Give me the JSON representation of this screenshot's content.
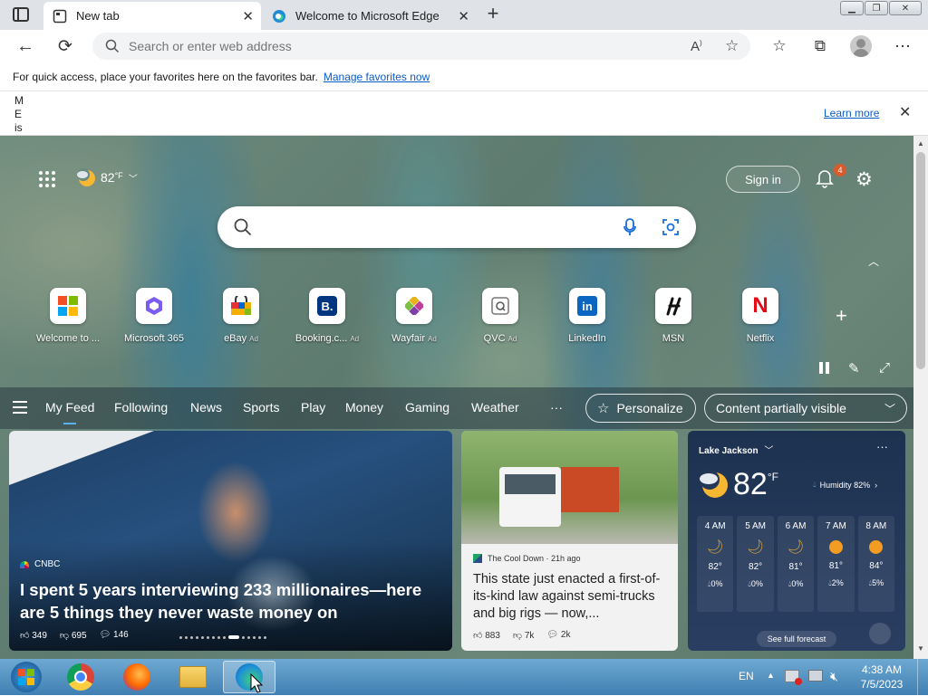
{
  "tabs": [
    {
      "title": "New tab",
      "active": true
    },
    {
      "title": "Welcome to Microsoft Edge",
      "active": false
    }
  ],
  "address_bar": {
    "placeholder": "Search or enter web address"
  },
  "favorites_bar": {
    "message": "For quick access, place your favorites here on the favorites bar.",
    "link": "Manage favorites now"
  },
  "infobar": {
    "partial_text": [
      "M",
      "E",
      "is"
    ],
    "learn_more": "Learn more"
  },
  "ntp": {
    "weather_temp": "82",
    "weather_unit": "°F",
    "sign_in": "Sign in",
    "notification_count": "4",
    "quick_links": [
      {
        "label": "Welcome to ...",
        "ad": ""
      },
      {
        "label": "Microsoft 365",
        "ad": ""
      },
      {
        "label": "eBay",
        "ad": "Ad"
      },
      {
        "label": "Booking.c...",
        "ad": "Ad"
      },
      {
        "label": "Wayfair",
        "ad": "Ad"
      },
      {
        "label": "QVC",
        "ad": "Ad"
      },
      {
        "label": "LinkedIn",
        "ad": ""
      },
      {
        "label": "MSN",
        "ad": ""
      },
      {
        "label": "Netflix",
        "ad": ""
      }
    ],
    "feed_tabs": [
      "My Feed",
      "Following",
      "News",
      "Sports",
      "Play",
      "Money",
      "Gaming",
      "Weather"
    ],
    "more": "···",
    "personalize": "Personalize",
    "content_visibility": "Content partially visible"
  },
  "cards": {
    "main": {
      "source": "CNBC",
      "headline": "I spent 5 years interviewing 233 millionaires—here are 5 things they never waste money on",
      "likes": "349",
      "dislikes": "695",
      "comments": "146"
    },
    "second": {
      "source": "The Cool Down · 21h ago",
      "headline": "This state just enacted a first-of-its-kind law against semi-trucks and big rigs — now,...",
      "likes": "883",
      "dislikes": "7k",
      "comments": "2k"
    },
    "weather": {
      "location": "Lake Jackson",
      "temp": "82",
      "unit": "°F",
      "humidity": "Humidity 82%",
      "forecast_link": "See full forecast",
      "hours": [
        {
          "time": "4 AM",
          "temp": "82°",
          "precip": "0%",
          "icon": "moon"
        },
        {
          "time": "5 AM",
          "temp": "82°",
          "precip": "0%",
          "icon": "moon"
        },
        {
          "time": "6 AM",
          "temp": "81°",
          "precip": "0%",
          "icon": "moon"
        },
        {
          "time": "7 AM",
          "temp": "81°",
          "precip": "2%",
          "icon": "sun"
        },
        {
          "time": "8 AM",
          "temp": "84°",
          "precip": "5%",
          "icon": "sun"
        }
      ]
    }
  },
  "taskbar": {
    "language": "EN",
    "time": "4:38 AM",
    "date": "7/5/2023"
  }
}
